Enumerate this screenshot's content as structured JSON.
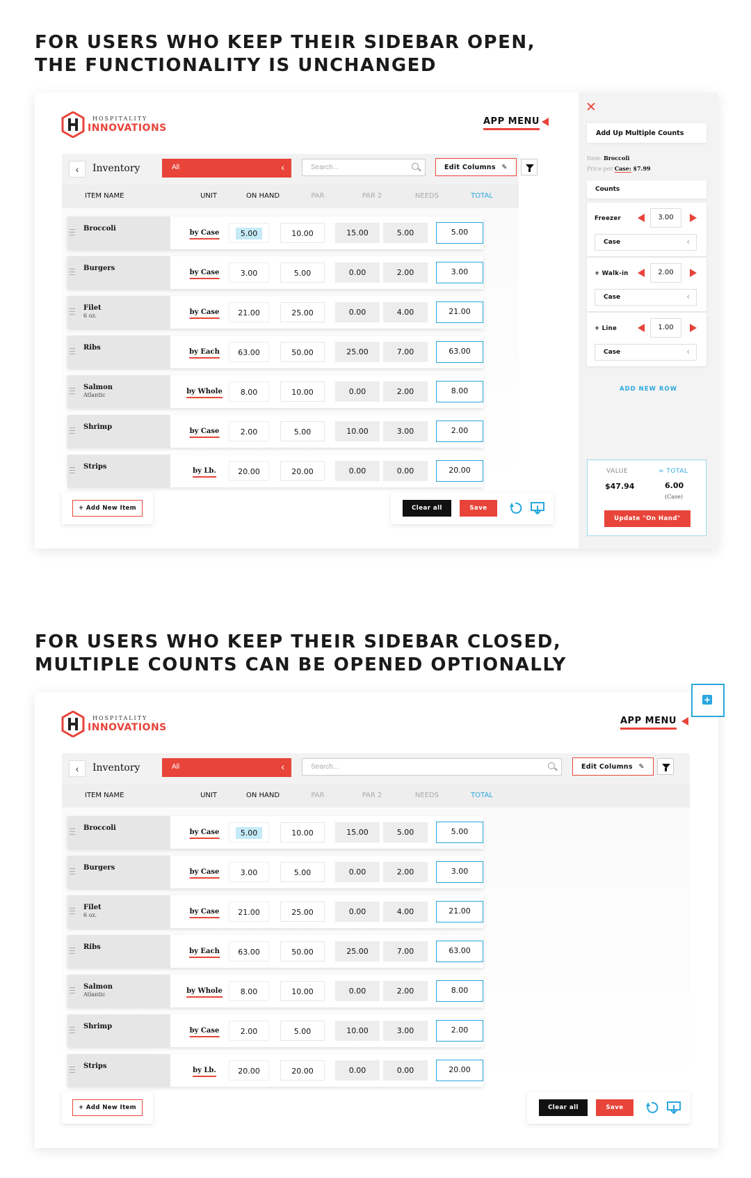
{
  "headline1": {
    "line1": "FOR USERS WHO KEEP THEIR SIDEBAR OPEN,",
    "line2": "THE FUNCTIONALITY IS UNCHANGED"
  },
  "headline2": {
    "line1": "FOR USERS WHO KEEP THEIR SIDEBAR CLOSED,",
    "line2": "MULTIPLE COUNTS CAN BE OPENED OPTIONALLY"
  },
  "brand": {
    "small": "HOSPITALITY",
    "big": "INNOVATIONS",
    "mark": "H",
    "color": "#e8443a"
  },
  "app_menu": {
    "label": "APP MENU"
  },
  "toolbar": {
    "back_icon": "chevron-left-icon",
    "title": "Inventory",
    "category": "All",
    "search_placeholder": "Search...",
    "edit_columns": "Edit Columns",
    "filter_icon": "funnel-icon"
  },
  "columns": {
    "item_name": "ITEM NAME",
    "unit": "UNIT",
    "on_hand": "ON HAND",
    "par": "PAR",
    "par2": "PAR 2",
    "needs": "NEEDS",
    "total": "TOTAL"
  },
  "rows": [
    {
      "name": "Broccoli",
      "sub": "",
      "unit": "by Case",
      "on_hand": "5.00",
      "par": "10.00",
      "par2": "15.00",
      "needs": "5.00",
      "total": "5.00"
    },
    {
      "name": "Burgers",
      "sub": "",
      "unit": "by Case",
      "on_hand": "3.00",
      "par": "5.00",
      "par2": "0.00",
      "needs": "2.00",
      "total": "3.00"
    },
    {
      "name": "Filet",
      "sub": "6 oz.",
      "unit": "by Case",
      "on_hand": "21.00",
      "par": "25.00",
      "par2": "0.00",
      "needs": "4.00",
      "total": "21.00"
    },
    {
      "name": "Ribs",
      "sub": "",
      "unit": "by Each",
      "on_hand": "63.00",
      "par": "50.00",
      "par2": "25.00",
      "needs": "7.00",
      "total": "63.00"
    },
    {
      "name": "Salmon",
      "sub": "Atlantic",
      "unit": "by Whole",
      "on_hand": "8.00",
      "par": "10.00",
      "par2": "0.00",
      "needs": "2.00",
      "total": "8.00"
    },
    {
      "name": "Shrimp",
      "sub": "",
      "unit": "by Case",
      "on_hand": "2.00",
      "par": "5.00",
      "par2": "10.00",
      "needs": "3.00",
      "total": "2.00"
    },
    {
      "name": "Strips",
      "sub": "",
      "unit": "by Lb.",
      "on_hand": "20.00",
      "par": "20.00",
      "par2": "0.00",
      "needs": "0.00",
      "total": "20.00"
    }
  ],
  "actions": {
    "add_item": "+ Add New Item",
    "clear_all": "Clear all",
    "save": "Save",
    "undo_icon": "undo-icon",
    "download_icon": "download-icon"
  },
  "sidebar": {
    "close_icon": "close-icon",
    "title": "Add Up Multiple Counts",
    "item_label": "Item:",
    "item_value": "Broccoli",
    "price_label": "Price per",
    "price_unit": "Case:",
    "price_value": "$7.99",
    "counts_label": "Counts",
    "counts": [
      {
        "location": "Freezer",
        "qty": "3.00",
        "unit": "Case"
      },
      {
        "location": "+ Walk-in",
        "qty": "2.00",
        "unit": "Case"
      },
      {
        "location": "+ Line",
        "qty": "1.00",
        "unit": "Case"
      }
    ],
    "add_row": "ADD NEW ROW",
    "value_label": "VALUE",
    "value": "$47.94",
    "total_label": "= TOTAL",
    "total": "6.00",
    "total_unit": "(Case)",
    "update_button": "Update \"On Hand\""
  },
  "open_counts_icon": "add-counts-icon",
  "accent_blue": "#29a7df"
}
